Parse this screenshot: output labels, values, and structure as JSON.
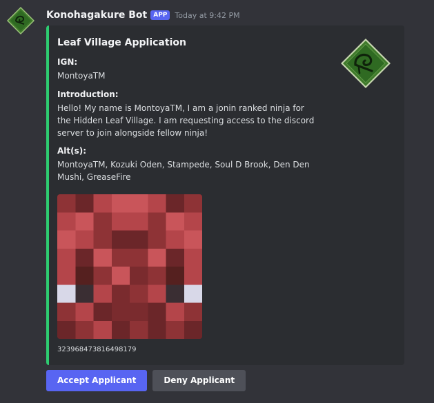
{
  "message": {
    "author": "Konohagakure Bot",
    "badge": "APP",
    "timestamp": "Today at 9:42 PM",
    "avatar_icon": "leaf-village-emblem-icon"
  },
  "embed": {
    "accent_color": "#2ecc71",
    "title": "Leaf Village Application",
    "thumbnail_icon": "leaf-village-emblem-icon",
    "fields": {
      "ign": {
        "name": "IGN:",
        "value": "MontoyaTM"
      },
      "introduction": {
        "name": "Introduction:",
        "value": "Hello! My name is MontoyaTM, I am a jonin ranked ninja for the Hidden Leaf Village. I am requesting access to the discord server to join alongside fellow ninja!"
      },
      "alts": {
        "name": "Alt(s):",
        "value": "MontoyaTM, Kozuki Oden, Stampede, Soul D Brook, Den Den Mushi, GreaseFire"
      }
    },
    "image_icon": "minecraft-skin-face-image",
    "footer": "323968473816498179"
  },
  "buttons": {
    "accept_label": "Accept Applicant",
    "deny_label": "Deny Applicant"
  },
  "colors": {
    "background": "#323339",
    "embed_background": "#2b2d31",
    "primary_button": "#5865f2",
    "secondary_button": "#4e5058"
  }
}
